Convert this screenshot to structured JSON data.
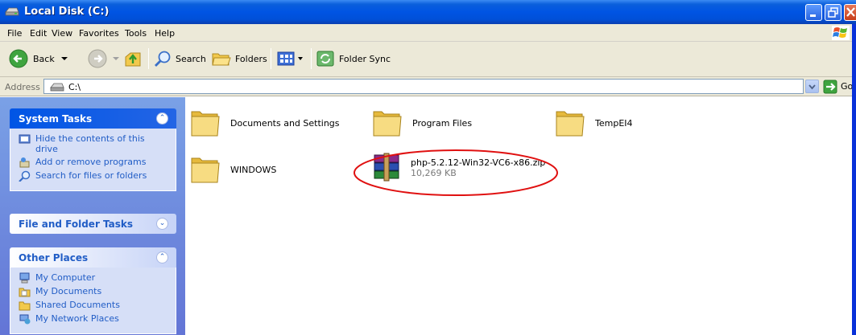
{
  "window": {
    "title": "Local Disk (C:)",
    "title_icon": "drive-icon"
  },
  "menu": [
    "File",
    "Edit",
    "View",
    "Favorites",
    "Tools",
    "Help"
  ],
  "toolbar": {
    "back_label": "Back",
    "search_label": "Search",
    "folders_label": "Folders",
    "sync_label": "Folder Sync"
  },
  "address": {
    "label": "Address",
    "value": "C:\\",
    "go_label": "Go"
  },
  "sidebar": {
    "system_tasks": {
      "title": "System Tasks",
      "items": [
        {
          "label": "Hide the contents of this drive",
          "icon": "hide-contents-icon"
        },
        {
          "label": "Add or remove programs",
          "icon": "add-remove-programs-icon"
        },
        {
          "label": "Search for files or folders",
          "icon": "search-icon"
        }
      ]
    },
    "file_tasks": {
      "title": "File and Folder Tasks"
    },
    "other_places": {
      "title": "Other Places",
      "items": [
        {
          "label": "My Computer",
          "icon": "computer-icon"
        },
        {
          "label": "My Documents",
          "icon": "my-documents-icon"
        },
        {
          "label": "Shared Documents",
          "icon": "shared-documents-icon"
        },
        {
          "label": "My Network Places",
          "icon": "network-places-icon"
        }
      ]
    }
  },
  "files": [
    {
      "name": "Documents and Settings",
      "type": "folder"
    },
    {
      "name": "Program Files",
      "type": "folder"
    },
    {
      "name": "TempEI4",
      "type": "folder"
    },
    {
      "name": "WINDOWS",
      "type": "folder"
    },
    {
      "name": "php-5.2.12-Win32-VC6-x86.zip",
      "type": "archive",
      "size": "10,269 KB",
      "highlighted": true
    }
  ],
  "colors": {
    "titlebar": "#0054e3",
    "highlight_ellipse": "#e01010",
    "task_link": "#215dc6"
  }
}
